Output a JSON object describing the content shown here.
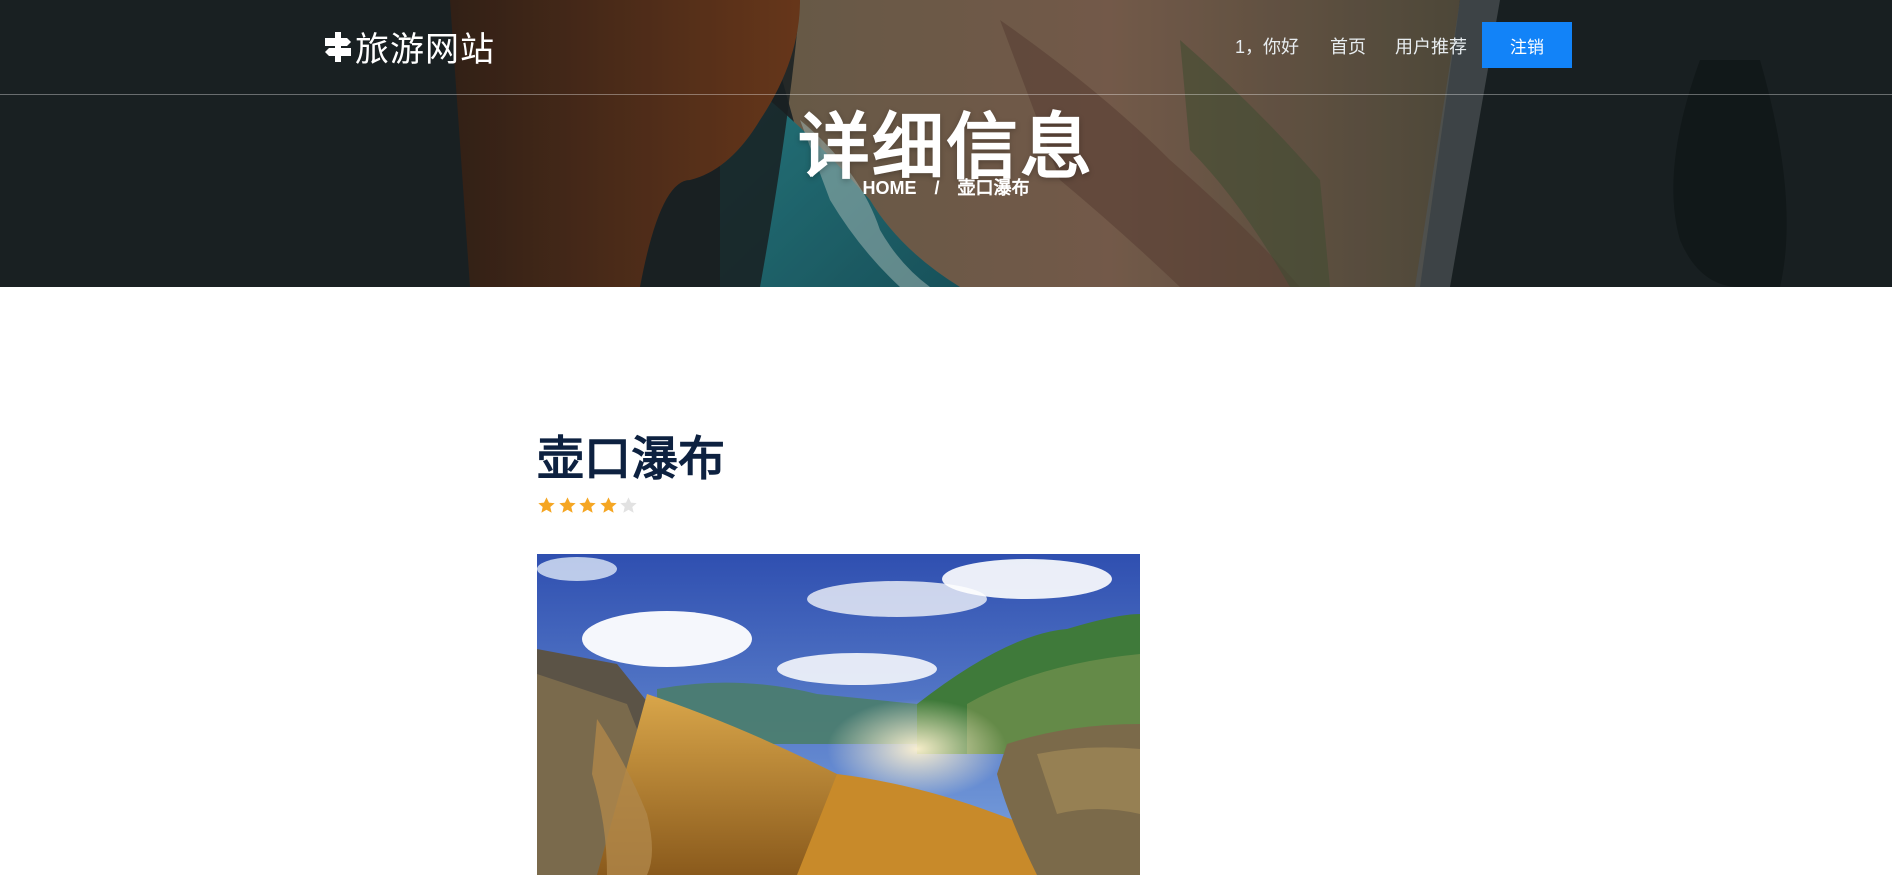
{
  "header": {
    "logo_text": "旅游网站",
    "logo_icon": "signpost-icon",
    "nav": {
      "greeting": "1，你好",
      "home": "首页",
      "recommend": "用户推荐",
      "logout": "注销"
    }
  },
  "hero": {
    "title": "详细信息",
    "breadcrumb": {
      "home": "HOME",
      "separator": "/",
      "current": "壶口瀑布"
    }
  },
  "detail": {
    "title": "壶口瀑布",
    "rating": {
      "value": 4,
      "max": 5
    }
  },
  "colors": {
    "accent": "#1283f8",
    "title": "#0d2140",
    "star_on": "#f5a623",
    "star_off": "#e2e2e2"
  }
}
